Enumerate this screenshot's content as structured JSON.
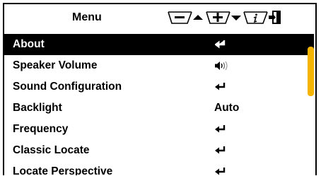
{
  "header": {
    "title": "Menu",
    "buttons": [
      {
        "name": "minus-up-button",
        "icon": "minus-icon",
        "arrow": "up-arrow-icon"
      },
      {
        "name": "plus-down-button",
        "icon": "plus-icon",
        "arrow": "down-arrow-icon"
      },
      {
        "name": "info-button",
        "icon": "info-icon"
      },
      {
        "name": "exit-button",
        "icon": "exit-icon"
      }
    ]
  },
  "menu": {
    "items": [
      {
        "label": "About",
        "value": "",
        "icon": "enter-icon",
        "selected": true
      },
      {
        "label": "Speaker Volume",
        "value": "",
        "icon": "speaker-icon",
        "selected": false
      },
      {
        "label": "Sound Configuration",
        "value": "",
        "icon": "enter-icon",
        "selected": false
      },
      {
        "label": "Backlight",
        "value": "Auto",
        "icon": "",
        "selected": false
      },
      {
        "label": "Frequency",
        "value": "",
        "icon": "enter-icon",
        "selected": false
      },
      {
        "label": "Classic Locate",
        "value": "",
        "icon": "enter-icon",
        "selected": false
      },
      {
        "label": "Locate Perspective",
        "value": "",
        "icon": "enter-icon",
        "selected": false
      }
    ]
  },
  "colors": {
    "selection": "#000000",
    "scrollbar": "#f5b400"
  }
}
